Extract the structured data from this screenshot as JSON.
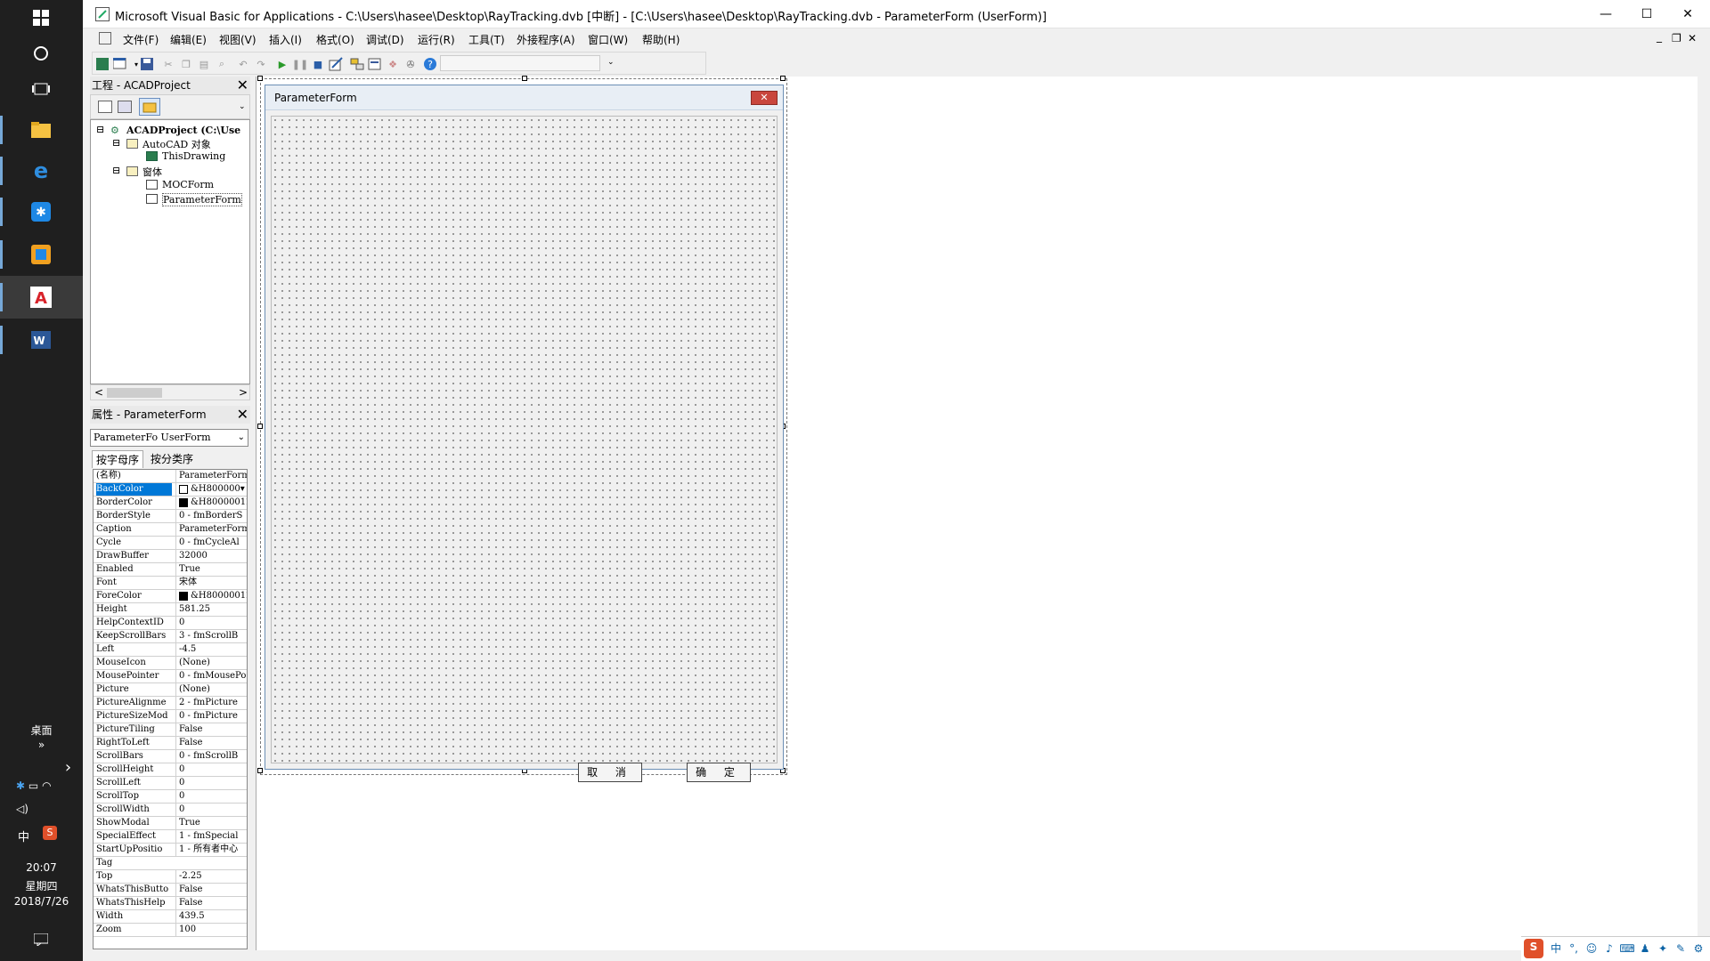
{
  "taskbar": {
    "icons": [
      "windows-icon",
      "cortana-icon",
      "task-view-icon",
      "file-explorer-icon",
      "edge-icon",
      "app-star-icon",
      "app-store-icon",
      "autocad-icon",
      "word-icon"
    ],
    "desktop_label": "桌面",
    "desktop_chevron": "»",
    "expand_chevron": "›",
    "ime_label": "中",
    "sogou_label": "S",
    "clock_time": "20:07",
    "clock_day": "星期四",
    "clock_date": "2018/7/26"
  },
  "window": {
    "title": "Microsoft Visual Basic for Applications - C:\\Users\\hasee\\Desktop\\RayTracking.dvb [中断] - [C:\\Users\\hasee\\Desktop\\RayTracking.dvb - ParameterForm (UserForm)]",
    "minimize": "—",
    "maximize": "☐",
    "close": "✕",
    "inner_min": "_",
    "inner_restore": "❐",
    "inner_close": "✕"
  },
  "menu": [
    "文件(F)",
    "编辑(E)",
    "视图(V)",
    "插入(I)",
    "格式(O)",
    "调试(D)",
    "运行(R)",
    "工具(T)",
    "外接程序(A)",
    "窗口(W)",
    "帮助(H)"
  ],
  "project": {
    "header": "工程 - ACADProject",
    "close": "✕",
    "tree": {
      "root": "ACADProject (C:\\Use",
      "acad_folder": "AutoCAD 对象",
      "this_drawing": "ThisDrawing",
      "forms_folder": "窗体",
      "form1": "MOCForm",
      "form2": "ParameterForm"
    },
    "scroll_left": "<",
    "scroll_right": ">"
  },
  "properties": {
    "header": "属性 - ParameterForm",
    "close": "✕",
    "object_combo": "ParameterFo UserForm",
    "tab_alpha": "按字母序",
    "tab_cat": "按分类序",
    "rows": [
      {
        "name": "(名称)",
        "value": "ParameterForm"
      },
      {
        "name": "BackColor",
        "value": "&H800000▾",
        "swatch": "#ffffff"
      },
      {
        "name": "BorderColor",
        "value": "&H80000012",
        "swatch": "#000000"
      },
      {
        "name": "BorderStyle",
        "value": "0 - fmBorderS"
      },
      {
        "name": "Caption",
        "value": "ParameterForm"
      },
      {
        "name": "Cycle",
        "value": "0 - fmCycleAl"
      },
      {
        "name": "DrawBuffer",
        "value": "32000"
      },
      {
        "name": "Enabled",
        "value": "True"
      },
      {
        "name": "Font",
        "value": "宋体"
      },
      {
        "name": "ForeColor",
        "value": "&H80000012",
        "swatch": "#000000"
      },
      {
        "name": "Height",
        "value": "581.25"
      },
      {
        "name": "HelpContextID",
        "value": "0"
      },
      {
        "name": "KeepScrollBars",
        "value": "3 - fmScrollB"
      },
      {
        "name": "Left",
        "value": "-4.5"
      },
      {
        "name": "MouseIcon",
        "value": "(None)"
      },
      {
        "name": "MousePointer",
        "value": "0 - fmMousePo"
      },
      {
        "name": "Picture",
        "value": "(None)"
      },
      {
        "name": "PictureAlignme",
        "value": "2 - fmPicture"
      },
      {
        "name": "PictureSizeMod",
        "value": "0 - fmPicture"
      },
      {
        "name": "PictureTiling",
        "value": "False"
      },
      {
        "name": "RightToLeft",
        "value": "False"
      },
      {
        "name": "ScrollBars",
        "value": "0 - fmScrollB"
      },
      {
        "name": "ScrollHeight",
        "value": "0"
      },
      {
        "name": "ScrollLeft",
        "value": "0"
      },
      {
        "name": "ScrollTop",
        "value": "0"
      },
      {
        "name": "ScrollWidth",
        "value": "0"
      },
      {
        "name": "ShowModal",
        "value": "True"
      },
      {
        "name": "SpecialEffect",
        "value": "1 - fmSpecial"
      },
      {
        "name": "StartUpPositio",
        "value": "1 - 所有者中心"
      },
      {
        "name": "Tag",
        "value": ""
      },
      {
        "name": "Top",
        "value": "-2.25"
      },
      {
        "name": "WhatsThisButto",
        "value": "False"
      },
      {
        "name": "WhatsThisHelp",
        "value": "False"
      },
      {
        "name": "Width",
        "value": "439.5"
      },
      {
        "name": "Zoom",
        "value": "100"
      }
    ]
  },
  "form": {
    "caption": "ParameterForm",
    "close": "✕",
    "cancel_label": "取 消",
    "ok_label": "确 定"
  },
  "tray": {
    "sogou": "S",
    "ime": "中"
  },
  "colors": {
    "taskbar_bg": "#1f1f1f",
    "selection": "#0078d7",
    "form_close": "#c9463d"
  }
}
